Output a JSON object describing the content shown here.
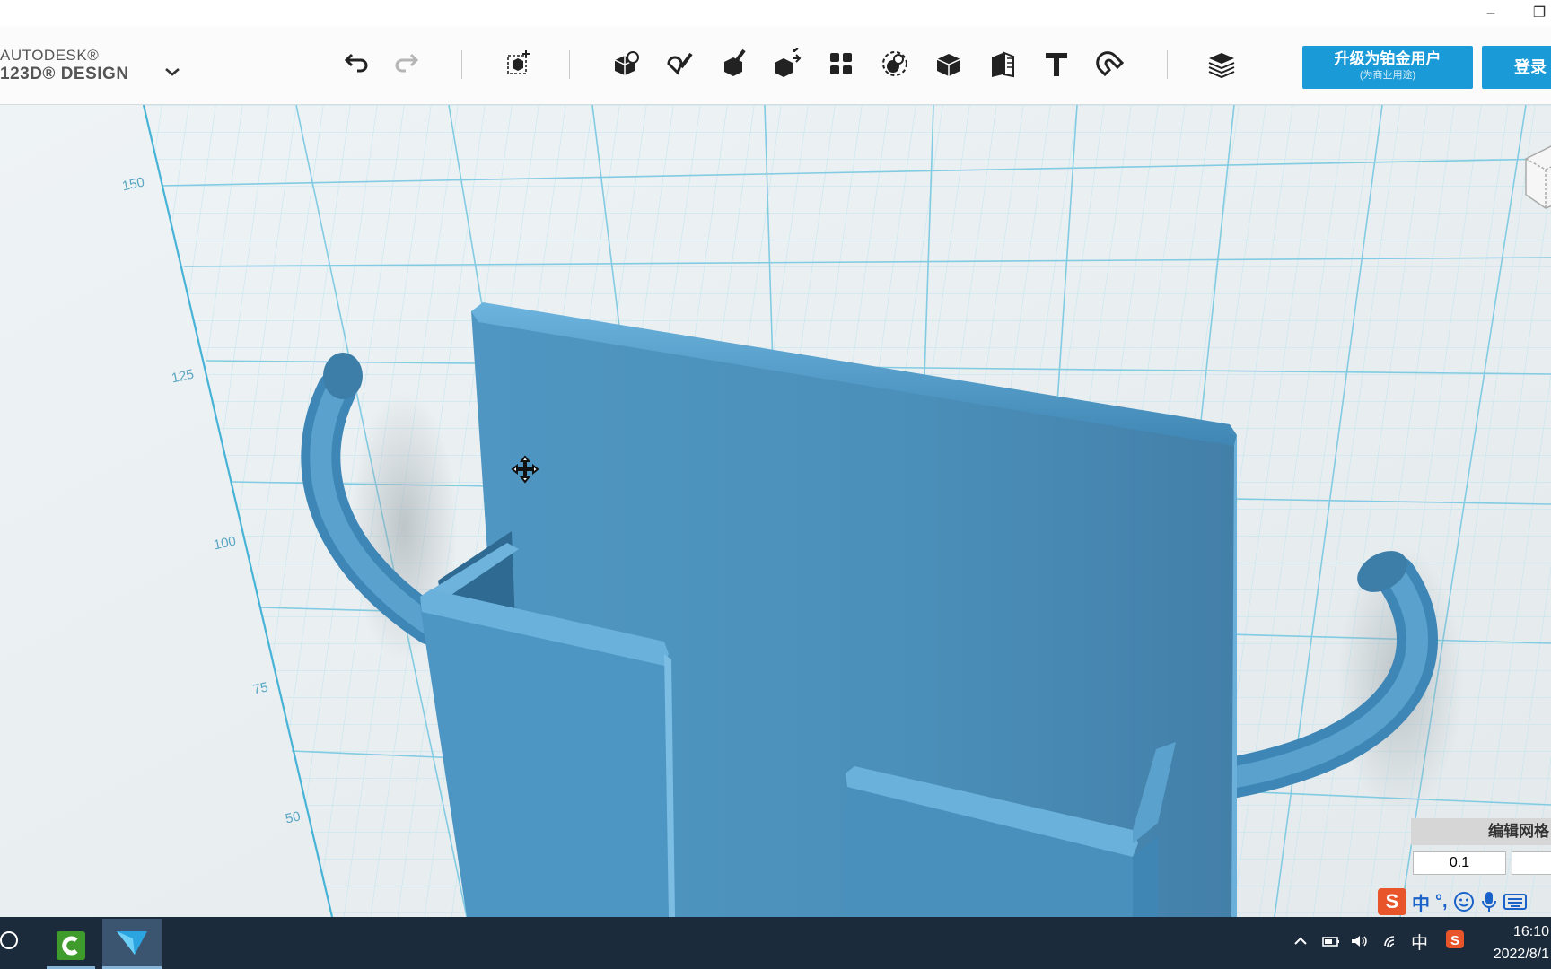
{
  "app": {
    "logo_line1": "AUTODESK®",
    "logo_line2": "123D® DESIGN",
    "menu_icon": "chevron-down-icon"
  },
  "window": {
    "minimize_glyph": "–",
    "restore_glyph": "❐"
  },
  "toolbar": {
    "tools": [
      {
        "name": "undo-icon"
      },
      {
        "name": "redo-icon"
      },
      {
        "name": "transform-icon"
      },
      {
        "name": "primitives-icon"
      },
      {
        "name": "sketch-icon"
      },
      {
        "name": "construct-icon"
      },
      {
        "name": "modify-icon"
      },
      {
        "name": "pattern-icon"
      },
      {
        "name": "grouping-icon"
      },
      {
        "name": "combine-icon"
      },
      {
        "name": "measure-icon"
      },
      {
        "name": "text-icon"
      },
      {
        "name": "snap-icon"
      },
      {
        "name": "material-icon"
      }
    ],
    "upgrade_label": "升级为铂金用户",
    "upgrade_sub": "(为商业用途)",
    "login_label": "登录"
  },
  "viewport": {
    "axis_labels": [
      "150",
      "125",
      "100",
      "75",
      "50"
    ],
    "model_color": "#4a90bd",
    "grid_color": "#8fd0e4"
  },
  "grid_panel": {
    "title": "编辑网格",
    "value": "0.1",
    "value2": ""
  },
  "ime": {
    "logo": "S",
    "mode": "中",
    "punct": "°,",
    "icons": [
      "emoji-icon",
      "microphone-icon",
      "keyboard-icon"
    ]
  },
  "taskbar": {
    "tray_ime": "中",
    "time": "16:10",
    "date": "2022/8/1"
  }
}
